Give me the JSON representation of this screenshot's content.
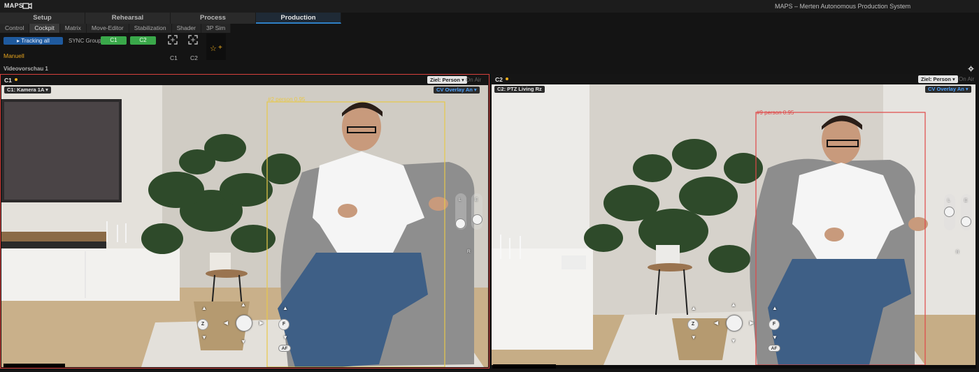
{
  "app": {
    "logo": "MAPS",
    "title": "MAPS – Merten Autonomous Production System"
  },
  "main_tabs": [
    {
      "label": "Setup"
    },
    {
      "label": "Rehearsal"
    },
    {
      "label": "Process"
    },
    {
      "label": "Production"
    }
  ],
  "sub_tabs": [
    {
      "label": "Control"
    },
    {
      "label": "Cockpit"
    },
    {
      "label": "Matrix"
    },
    {
      "label": "Move-Editor"
    },
    {
      "label": "Stabilization"
    },
    {
      "label": "Shader"
    },
    {
      "label": "3P Sim"
    }
  ],
  "toolbar": {
    "tracking_all": "▸ Tracking all",
    "sync_group_label": "SYNC Group",
    "sync_c1": "C1",
    "sync_c2": "C2",
    "focus_c1_label": "C1",
    "focus_c2_label": "C2",
    "fav_star": "☆",
    "fav_plus": "+",
    "mode": "Manuell",
    "section": "Videovorschau 1"
  },
  "panes": [
    {
      "id": "C1",
      "title": "C1",
      "camera_label": "C1: Kamera 1A ▾",
      "target": "Ziel: Person ▾",
      "on_air": "On Air",
      "cv_overlay": "CV Overlay An ▾",
      "detection": "#2 person 0.95",
      "detection_color": "#e8c84a",
      "controls": {
        "z": "Z",
        "f": "F",
        "af": "AF",
        "l": "L",
        "e": "E",
        "r": "R"
      }
    },
    {
      "id": "C2",
      "title": "C2",
      "camera_label": "C2: PTZ Living Rz",
      "target": "Ziel: Person ▾",
      "on_air": "On Air",
      "cv_overlay": "CV Overlay An ▾",
      "detection": "#9 person 0.95",
      "detection_color": "#e04848",
      "controls": {
        "z": "Z",
        "f": "F",
        "af": "AF",
        "l": "L",
        "e": "E",
        "r": "R"
      }
    }
  ],
  "colors": {
    "active_pane_border": "#d8403c",
    "tracking_button": "#1f5a9e",
    "sync_button": "#3aa84a",
    "accent_orange": "#e6a41e",
    "overlay_blue": "#4ea3ff"
  },
  "icons": [
    "camera-logo-icon",
    "focus-frame-icon",
    "star-icon",
    "plus-icon",
    "settings-gear-icon",
    "arrow-up-icon",
    "arrow-down-icon",
    "arrow-left-icon",
    "arrow-right-icon"
  ]
}
